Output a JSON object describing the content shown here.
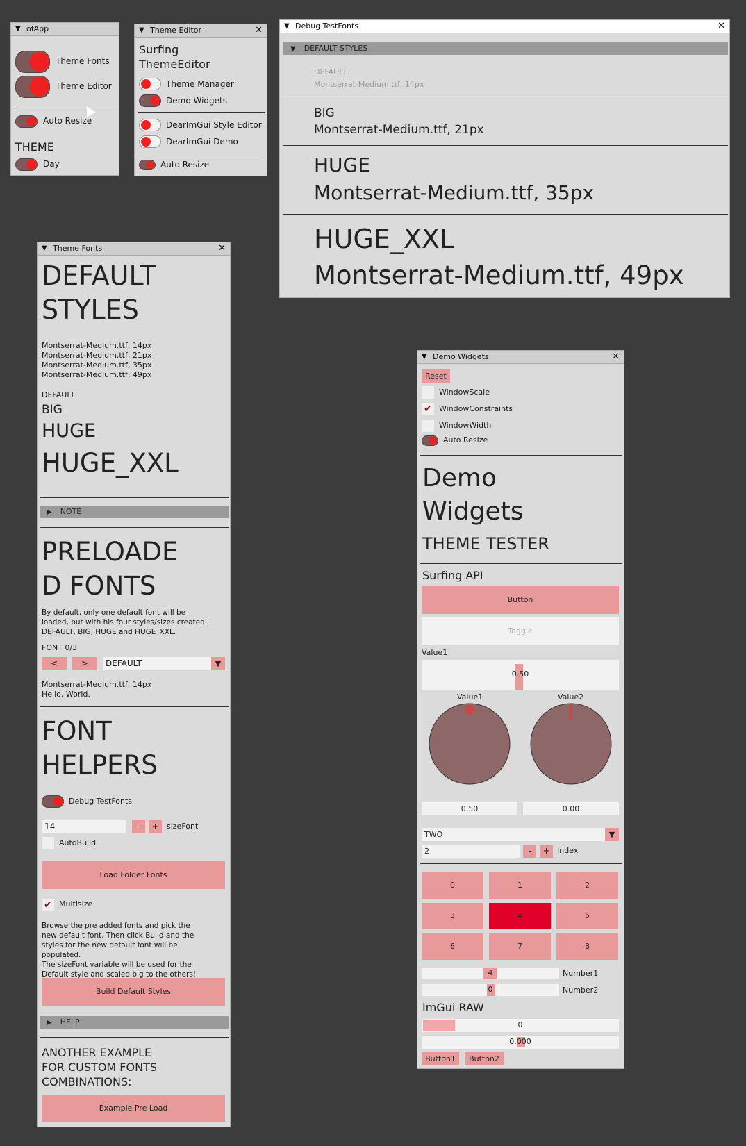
{
  "ofapp": {
    "title": "ofApp",
    "toggles": [
      "Theme Fonts",
      "Theme Editor"
    ],
    "auto_resize": "Auto Resize",
    "theme_label": "THEME",
    "theme_value": "Day"
  },
  "theme_editor": {
    "title": "Theme Editor",
    "heading": [
      "Surfing",
      "ThemeEditor"
    ],
    "items": [
      "Theme Manager",
      "Demo Widgets",
      "DearImGui Style Editor",
      "DearImGui Demo",
      "Auto Resize"
    ]
  },
  "debug": {
    "title": "Debug TestFonts",
    "section": "DEFAULT STYLES",
    "styles": [
      {
        "name": "DEFAULT",
        "desc": "Montserrat-Medium.ttf, 14px"
      },
      {
        "name": "BIG",
        "desc": "Montserrat-Medium.ttf, 21px"
      },
      {
        "name": "HUGE",
        "desc": "Montserrat-Medium.ttf, 35px"
      },
      {
        "name": "HUGE_XXL",
        "desc": "Montserrat-Medium.ttf, 49px"
      }
    ]
  },
  "theme_fonts": {
    "title": "Theme Fonts",
    "heading": [
      "DEFAULT",
      "STYLES"
    ],
    "list": [
      "Montserrat-Medium.ttf, 14px",
      "Montserrat-Medium.ttf, 21px",
      "Montserrat-Medium.ttf, 35px",
      "Montserrat-Medium.ttf, 49px"
    ],
    "samples": [
      "DEFAULT",
      "BIG",
      "HUGE",
      "HUGE_XXL"
    ],
    "note": "NOTE",
    "preloaded": [
      "PRELOADE",
      "D FONTS"
    ],
    "preloaded_text": [
      "By default, only one default font will be",
      "loaded, but with his four styles/sizes created:",
      "DEFAULT, BIG, HUGE and HUGE_XXL."
    ],
    "font_counter": "FONT 0/3",
    "prev": "<",
    "next": ">",
    "font_select": "DEFAULT",
    "font_info": [
      "Montserrat-Medium.ttf, 14px",
      "Hello, World."
    ],
    "helpers": [
      "FONT",
      "HELPERS"
    ],
    "debug_toggle": "Debug TestFonts",
    "size_value": "14",
    "minus": "-",
    "plus": "+",
    "size_label": "sizeFont",
    "autobuild": "AutoBuild",
    "load_folder": "Load Folder Fonts",
    "multisize": "Multisize",
    "browse_text": [
      "Browse the pre added fonts and pick the",
      "new default font. Then click Build and the",
      "styles for the new default font will be",
      "populated.",
      "The sizeFont variable will be used for the",
      "Default style and scaled big to the others!"
    ],
    "build": "Build Default Styles",
    "help": "HELP",
    "another": [
      "ANOTHER EXAMPLE",
      "FOR CUSTOM FONTS",
      "COMBINATIONS:"
    ],
    "example": "Example Pre Load"
  },
  "demo": {
    "title": "Demo Widgets",
    "reset": "Reset",
    "checks": [
      {
        "label": "WindowScale",
        "checked": false
      },
      {
        "label": "WindowConstraints",
        "checked": true
      },
      {
        "label": "WindowWidth",
        "checked": false
      }
    ],
    "auto_resize": "Auto Resize",
    "heading": [
      "Demo",
      "Widgets"
    ],
    "tester": "THEME TESTER",
    "api": "Surfing API",
    "button": "Button",
    "toggle": "Toggle",
    "value1_label": "Value1",
    "value1": "0.50",
    "knob1_label": "Value1",
    "knob2_label": "Value2",
    "knob1_value": "0.50",
    "knob2_value": "0.00",
    "combo": "TWO",
    "index_value": "2",
    "minus": "-",
    "plus": "+",
    "index_label": "Index",
    "grid": [
      "0",
      "1",
      "2",
      "3",
      "4",
      "5",
      "6",
      "7",
      "8"
    ],
    "grid_selected": 4,
    "number1": "4",
    "number1_label": "Number1",
    "number2": "0",
    "number2_label": "Number2",
    "raw": "ImGui RAW",
    "raw_int": "0",
    "raw_float": "0.000",
    "button1": "Button1",
    "button2": "Button2"
  }
}
